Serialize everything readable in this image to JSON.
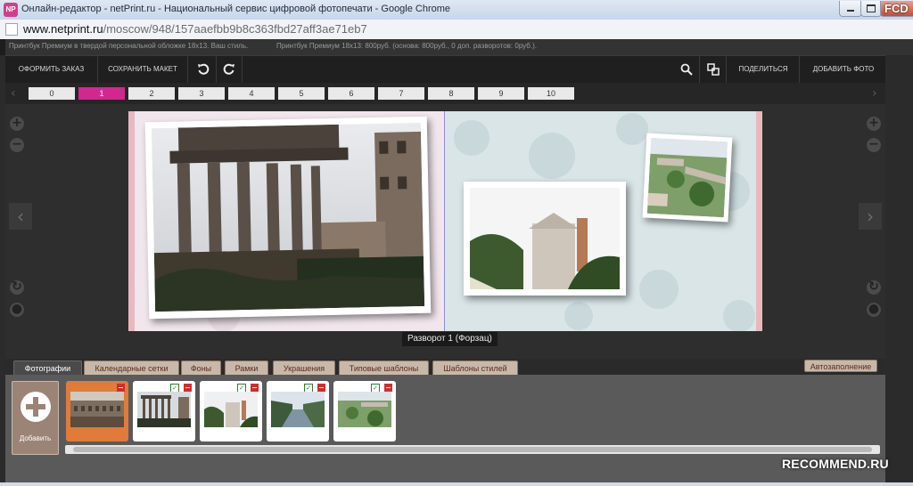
{
  "window": {
    "title": "Онлайн-редактор - netPrint.ru - Национальный сервис цифровой фотопечати - Google Chrome",
    "app_icon_text": "NP",
    "corner_label": "FCD"
  },
  "address_bar": {
    "host": "www.netprint.ru",
    "path": "/moscow/948/157aaefbb9b8c363fbd27aff3ae71eb7"
  },
  "info": {
    "product": "Принтбук Премиум в твердой персональной обложке 18х13. Ваш стиль.",
    "price": "Принтбук Премиум 18х13: 800руб. (основа: 800руб., 0 доп. разворотов: 0руб.)."
  },
  "toolbar": {
    "order_label": "ОФОРМИТЬ ЗАКАЗ",
    "save_label": "СОХРАНИТЬ МАКЕТ",
    "undo_icon": "undo-icon",
    "redo_icon": "redo-icon",
    "zoom_icon": "search-icon",
    "preview_icon": "layout-icon",
    "share_label": "ПОДЕЛИТЬСЯ",
    "add_photo_label": "ДОБАВИТЬ ФОТО"
  },
  "pages": {
    "items": [
      "0",
      "1",
      "2",
      "3",
      "4",
      "5",
      "6",
      "7",
      "8",
      "9",
      "10"
    ],
    "active": "1"
  },
  "spread": {
    "label": "Разворот 1 (Форзац)"
  },
  "tabs": {
    "items": [
      "Фотографии",
      "Календарные сетки",
      "Фоны",
      "Рамки",
      "Украшения",
      "Типовые шаблоны",
      "Шаблоны стилей"
    ],
    "active": "Фотографии",
    "autofill_label": "Автозаполнение"
  },
  "photos": {
    "add_label": "Добавить",
    "items": [
      {
        "subject": "colosseum",
        "state": "used"
      },
      {
        "subject": "forum-columns",
        "state": "selected"
      },
      {
        "subject": "church",
        "state": "selected"
      },
      {
        "subject": "canal",
        "state": "selected"
      },
      {
        "subject": "vatican-gardens",
        "state": "selected"
      }
    ]
  },
  "watermark": "RECOMMEND.RU",
  "colors": {
    "accent": "#d2278f",
    "used_thumb": "#e07b39",
    "tab_bg": "#c8b8aa",
    "page_border": "#eab7bd"
  }
}
